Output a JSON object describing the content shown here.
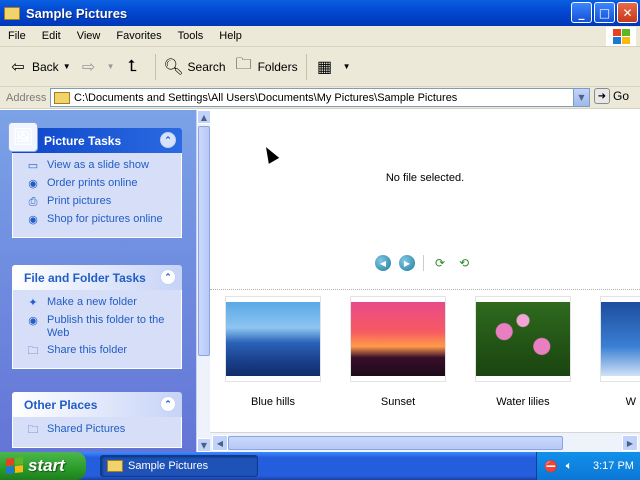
{
  "window": {
    "title": "Sample Pictures",
    "controls": [
      "minimize",
      "maximize",
      "close"
    ]
  },
  "menu": [
    "File",
    "Edit",
    "View",
    "Favorites",
    "Tools",
    "Help"
  ],
  "toolbar": {
    "back_label": "Back",
    "search_label": "Search",
    "folders_label": "Folders"
  },
  "address": {
    "label": "Address",
    "value": "C:\\Documents and Settings\\All Users\\Documents\\My Pictures\\Sample Pictures",
    "go_label": "Go"
  },
  "taskpane": {
    "picture_tasks": {
      "title": "Picture Tasks",
      "items": [
        {
          "label": "View as a slide show",
          "icon": "slideshow-icon"
        },
        {
          "label": "Order prints online",
          "icon": "globe-icon"
        },
        {
          "label": "Print pictures",
          "icon": "printer-icon"
        },
        {
          "label": "Shop for pictures online",
          "icon": "globe-icon"
        }
      ]
    },
    "file_folder_tasks": {
      "title": "File and Folder Tasks",
      "items": [
        {
          "label": "Make a new folder",
          "icon": "new-folder-icon"
        },
        {
          "label": "Publish this folder to the Web",
          "icon": "globe-icon"
        },
        {
          "label": "Share this folder",
          "icon": "share-folder-icon"
        }
      ]
    },
    "other_places": {
      "title": "Other Places",
      "items": [
        {
          "label": "Shared Pictures",
          "icon": "folder-icon"
        }
      ]
    }
  },
  "preview": {
    "status": "No file selected."
  },
  "thumbnails": [
    {
      "caption": "Blue hills"
    },
    {
      "caption": "Sunset"
    },
    {
      "caption": "Water lilies"
    },
    {
      "caption": "W"
    }
  ],
  "taskbar": {
    "start_label": "start",
    "task_label": "Sample Pictures",
    "clock": "3:17 PM"
  }
}
